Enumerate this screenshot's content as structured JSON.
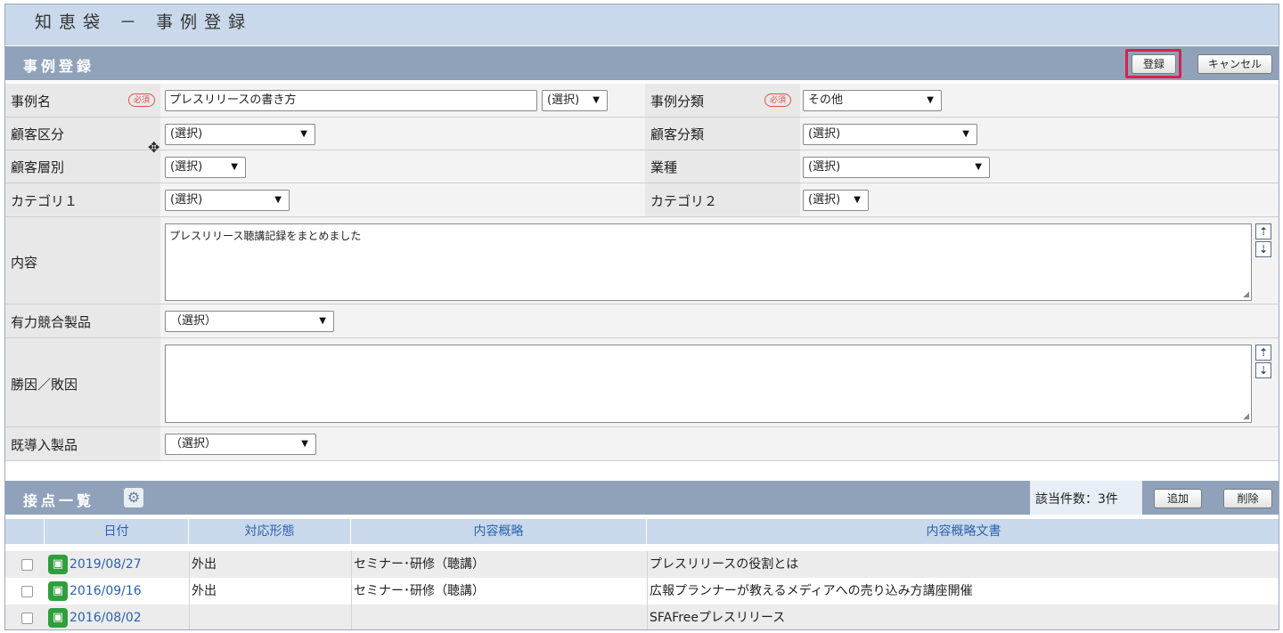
{
  "page_title": "知恵袋 － 事例登録",
  "form": {
    "section_title": "事例登録",
    "register_label": "登録",
    "cancel_label": "キャンセル",
    "required_badge": "必須",
    "case_name": {
      "label": "事例名",
      "value": "プレスリリースの書き方",
      "select": "(選択)"
    },
    "case_class": {
      "label": "事例分類",
      "value": "その他"
    },
    "customer_div": {
      "label": "顧客区分",
      "value": "(選択)"
    },
    "customer_class": {
      "label": "顧客分類",
      "value": "(選択)"
    },
    "customer_layer": {
      "label": "顧客層別",
      "value": "(選択)"
    },
    "industry": {
      "label": "業種",
      "value": "(選択)"
    },
    "category1": {
      "label": "カテゴリ１",
      "value": "(選択)"
    },
    "category2": {
      "label": "カテゴリ２",
      "value": "(選択)"
    },
    "content": {
      "label": "内容",
      "value": "プレスリリース聴講記録をまとめました"
    },
    "competitor": {
      "label": "有力競合製品",
      "value": "（選択）"
    },
    "win_loss": {
      "label": "勝因／敗因",
      "value": ""
    },
    "existing": {
      "label": "既導入製品",
      "value": "（選択）"
    }
  },
  "contacts": {
    "section_title": "接点一覧",
    "count_text": "該当件数：3件",
    "add_label": "追加",
    "delete_label": "削除",
    "columns": [
      "日付",
      "対応形態",
      "内容概略",
      "内容概略文書"
    ],
    "rows": [
      {
        "date": "2019/08/27",
        "type": "外出",
        "summary": "セミナー･研修（聴講）",
        "doc": "プレスリリースの役割とは"
      },
      {
        "date": "2016/09/16",
        "type": "外出",
        "summary": "セミナー･研修（聴講）",
        "doc": "広報プランナーが教えるメディアへの売り込み方講座開催"
      },
      {
        "date": "2016/08/02",
        "type": "",
        "summary": "",
        "doc": "SFAFreeプレスリリース"
      }
    ]
  },
  "colors": {
    "accent_red": "#d9204e",
    "header_blue": "#8fa2ba",
    "link_blue": "#2a62b0",
    "icon_green": "#2f9e3c"
  }
}
